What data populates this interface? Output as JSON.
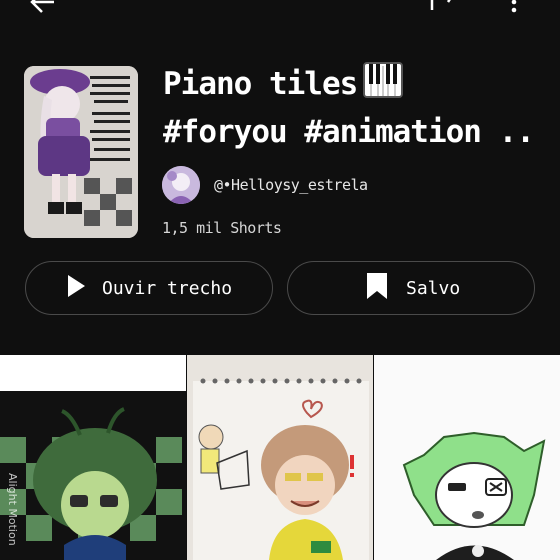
{
  "video": {
    "title_line1": "Piano tiles",
    "title_line2": "#foryou #animation ..",
    "emoji": "piano-keys-emoji"
  },
  "channel": {
    "handle": "@•Helloysy_estrela",
    "shorts_count": "1,5 mil Shorts"
  },
  "buttons": {
    "play_label": "Ouvir trecho",
    "save_label": "Salvo"
  },
  "grid": {
    "watermark": "Alight Motion"
  },
  "icons": [
    "back-arrow-icon",
    "share-icon",
    "more-vert-icon",
    "play-icon",
    "bookmark-icon"
  ],
  "colors": {
    "background": "#0f0f0f",
    "button_border": "#4a4a4a",
    "text": "#ffffff",
    "secondary_text": "#d6d6d6"
  }
}
